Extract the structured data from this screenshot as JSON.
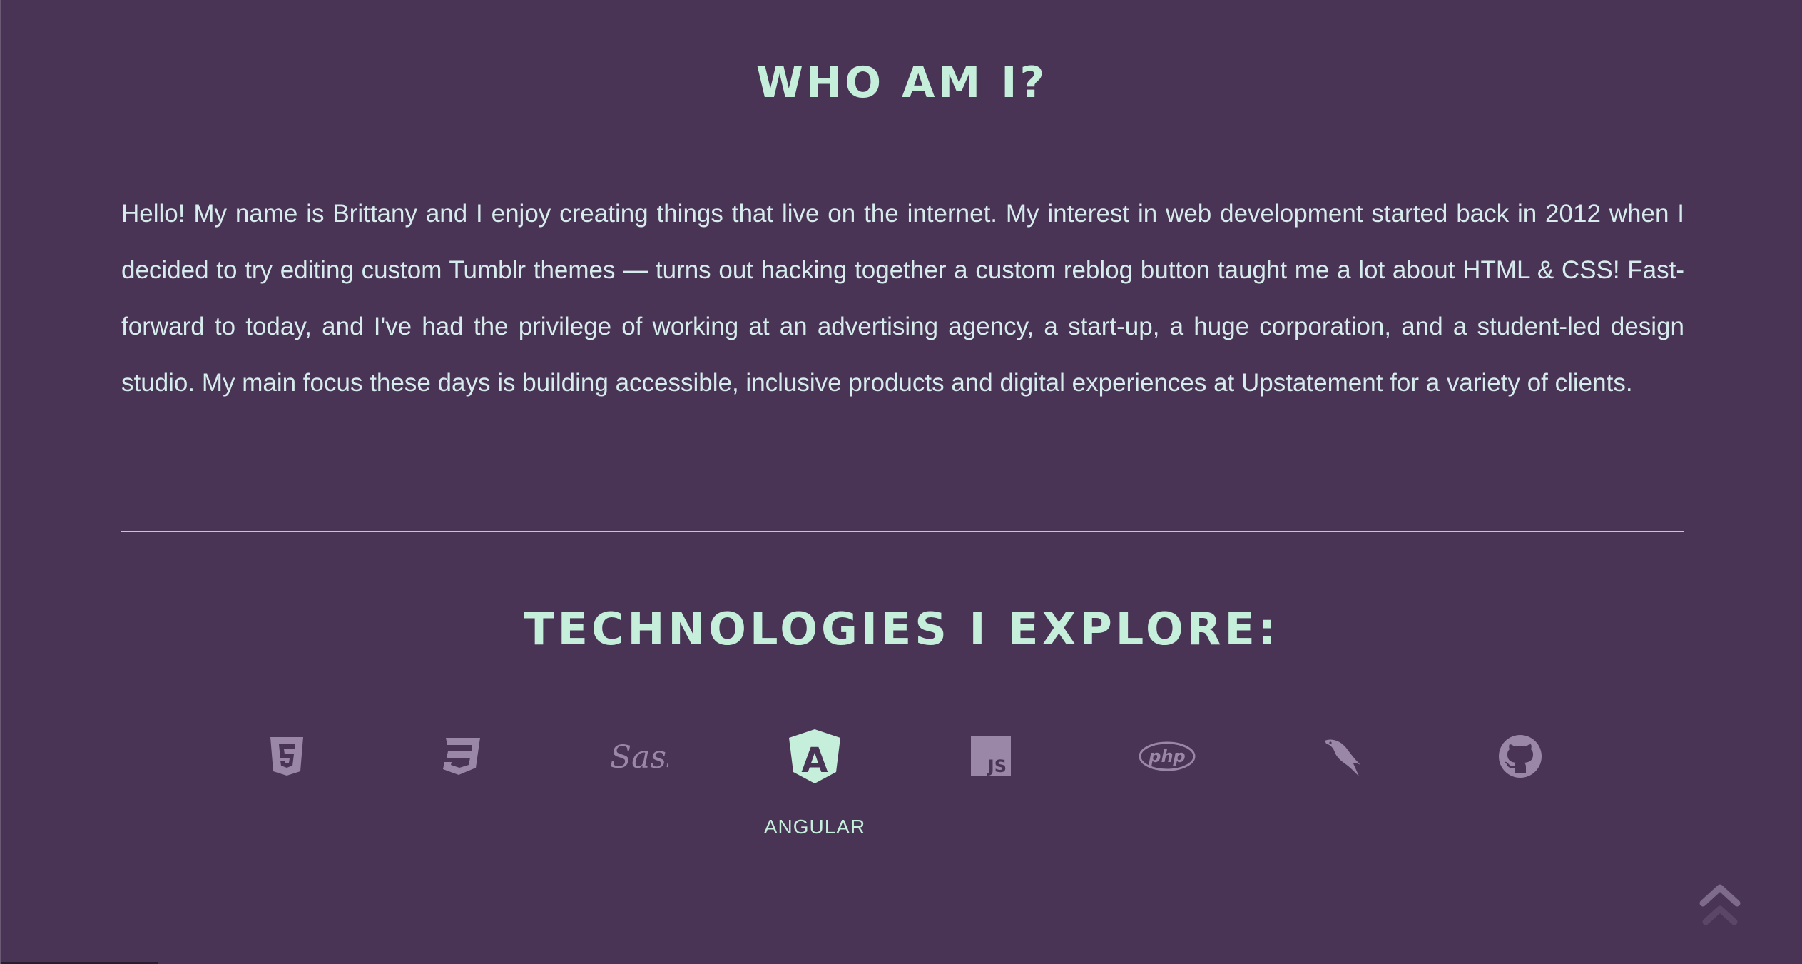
{
  "about": {
    "heading": "WHO AM I?",
    "paragraph": "Hello! My name is Brittany and I enjoy creating things that live on the internet. My interest in web development started back in 2012 when I decided to try editing custom Tumblr themes — turns out hacking together a custom reblog button taught me a lot about HTML & CSS! Fast-forward to today, and I've had the privilege of working at an advertising agency, a start-up, a huge corporation, and a student-led design studio. My main focus these days is building accessible, inclusive products and digital experiences at Upstatement for a variety of clients."
  },
  "technologies": {
    "heading": "TECHNOLOGIES I EXPLORE:",
    "items": [
      {
        "icon": "html5-icon",
        "label": "HTML5"
      },
      {
        "icon": "css3-icon",
        "label": "CSS3"
      },
      {
        "icon": "sass-icon",
        "label": "SASS",
        "glyph": "Sass"
      },
      {
        "icon": "angular-icon",
        "label": "ANGULAR",
        "glyph": "A"
      },
      {
        "icon": "javascript-icon",
        "label": "JAVASCRIPT",
        "glyph": "JS"
      },
      {
        "icon": "php-icon",
        "label": "PHP",
        "glyph": "php"
      },
      {
        "icon": "mysql-icon",
        "label": "MYSQL"
      },
      {
        "icon": "github-icon",
        "label": "GITHUB"
      }
    ],
    "active_label": "ANGULAR"
  },
  "colors": {
    "background": "#4a3455",
    "accent": "#c5eedb",
    "text": "#d6ecec",
    "icon_muted": "#9a86a6"
  },
  "scroll_top": {
    "icon": "chevron-up-icon"
  }
}
